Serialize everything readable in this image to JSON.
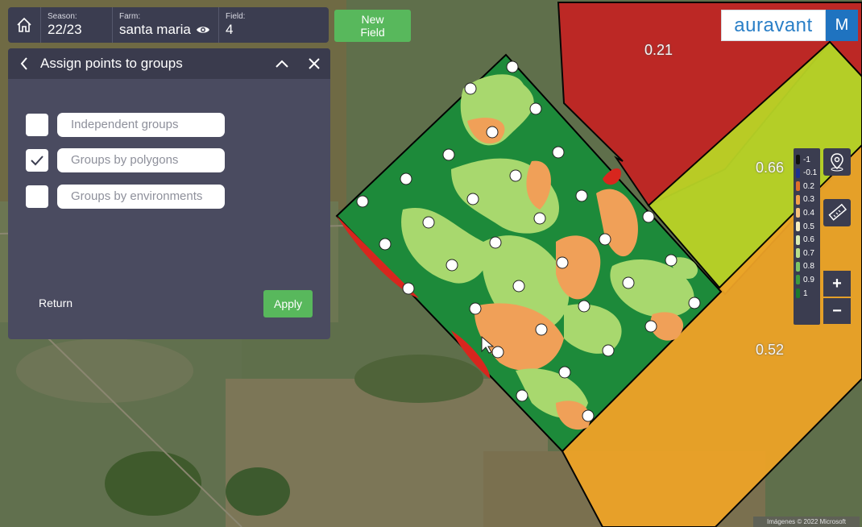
{
  "topbar": {
    "season_label": "Season:",
    "season_value": "22/23",
    "farm_label": "Farm:",
    "farm_value": "santa maria",
    "field_label": "Field:",
    "field_value": "4"
  },
  "new_field_label": "New\nField",
  "panel": {
    "title": "Assign points to groups",
    "options": [
      {
        "label": "Independent groups",
        "checked": false
      },
      {
        "label": "Groups by polygons",
        "checked": true
      },
      {
        "label": "Groups by environments",
        "checked": false
      }
    ],
    "return_label": "Return",
    "apply_label": "Apply"
  },
  "logo": {
    "text": "auravant",
    "user_initial": "M"
  },
  "legend": [
    {
      "value": "-1",
      "color": "#111111"
    },
    {
      "value": "-0.1",
      "color": "#1d2f8f"
    },
    {
      "value": "0.2",
      "color": "#e0702a"
    },
    {
      "value": "0.3",
      "color": "#f0a04b"
    },
    {
      "value": "0.4",
      "color": "#f7c27e"
    },
    {
      "value": "0.5",
      "color": "#f6edc0"
    },
    {
      "value": "0.6",
      "color": "#d9ecb5"
    },
    {
      "value": "0.7",
      "color": "#b8e08c"
    },
    {
      "value": "0.8",
      "color": "#7ec566"
    },
    {
      "value": "0.9",
      "color": "#3d9a3f"
    },
    {
      "value": "1",
      "color": "#1b7a2e"
    }
  ],
  "zones": [
    {
      "value": "0.21",
      "color": "#c42323"
    },
    {
      "value": "0.66",
      "color": "#b9d426"
    },
    {
      "value": "0.52",
      "color": "#eda327"
    }
  ],
  "zoom": {
    "in": "+",
    "out": "−"
  },
  "copyright": "Imágenes © 2022 Microsoft"
}
